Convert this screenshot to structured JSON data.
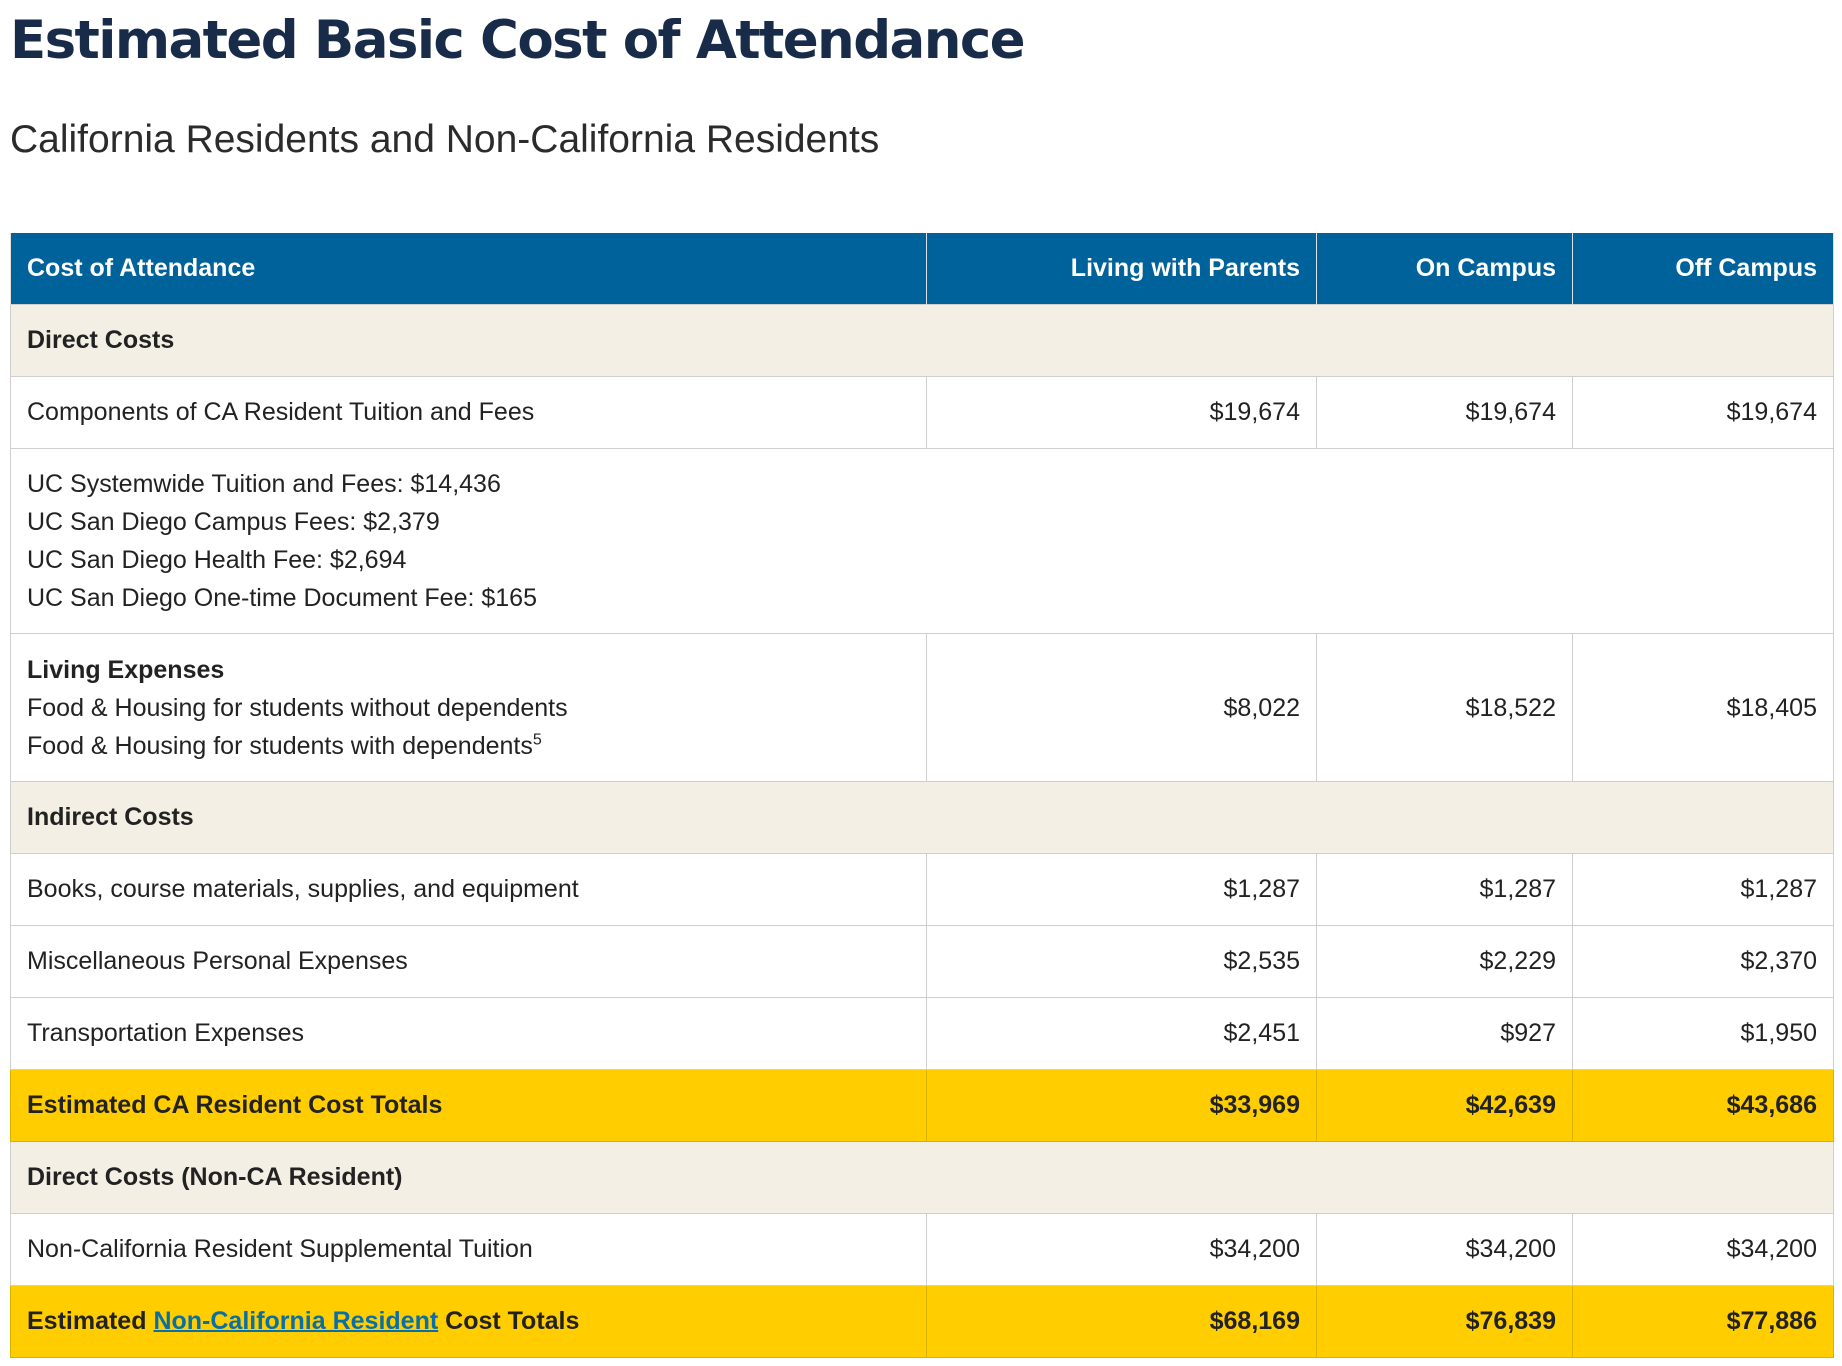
{
  "page": {
    "title": "Estimated Basic Cost of Attendance",
    "subtitle": "California Residents and Non-California Residents"
  },
  "table": {
    "headers": [
      "Cost of Attendance",
      "Living with Parents",
      "On Campus",
      "Off Campus"
    ],
    "direct_costs_heading": "Direct Costs",
    "tuition_row": {
      "label": "Components of CA Resident Tuition and Fees",
      "values": [
        "$19,674",
        "$19,674",
        "$19,674"
      ]
    },
    "tuition_breakdown": [
      "UC Systemwide Tuition and Fees: $14,436",
      "UC San Diego Campus Fees: $2,379",
      "UC San Diego Health Fee: $2,694",
      "UC San Diego One-time Document Fee: $165"
    ],
    "living_row": {
      "heading": "Living Expenses",
      "line1": "Food & Housing for students without dependents",
      "line2": "Food & Housing for students with dependents",
      "footnote": "5",
      "values": [
        "$8,022",
        "$18,522",
        "$18,405"
      ]
    },
    "indirect_costs_heading": "Indirect Costs",
    "books_row": {
      "label": "Books, course materials, supplies, and equipment",
      "values": [
        "$1,287",
        "$1,287",
        "$1,287"
      ]
    },
    "misc_row": {
      "label": "Miscellaneous Personal Expenses",
      "values": [
        "$2,535",
        "$2,229",
        "$2,370"
      ]
    },
    "transport_row": {
      "label": "Transportation Expenses",
      "values": [
        "$2,451",
        "$927",
        "$1,950"
      ]
    },
    "ca_total_row": {
      "label": "Estimated CA Resident Cost Totals",
      "values": [
        "$33,969",
        "$42,639",
        "$43,686"
      ]
    },
    "non_ca_heading": "Direct Costs (Non-CA Resident)",
    "supplemental_row": {
      "label": "Non-California Resident Supplemental Tuition",
      "values": [
        "$34,200",
        "$34,200",
        "$34,200"
      ]
    },
    "non_ca_total_row": {
      "label_prefix": "Estimated ",
      "link_text": "Non-California Resident",
      "label_suffix": " Cost Totals",
      "values": [
        "$68,169",
        "$76,839",
        "$77,886"
      ]
    }
  },
  "colors": {
    "title": "#182b49",
    "header_bg": "#00629b",
    "section_bg": "#f3efe4",
    "total_bg": "#ffcd00",
    "link": "#0a6fa5"
  }
}
